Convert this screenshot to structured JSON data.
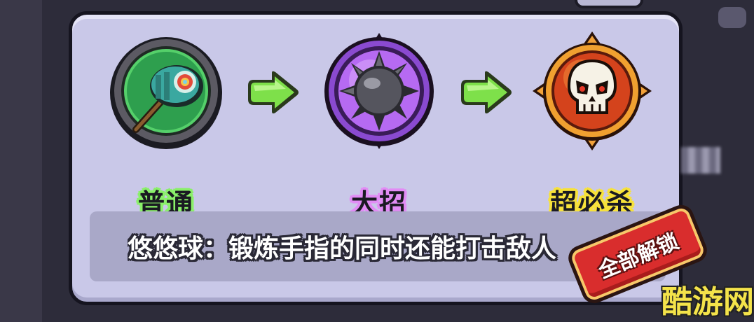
{
  "skills": [
    {
      "label": "普通",
      "icon": "yoyo-ball-icon"
    },
    {
      "label": "大招",
      "icon": "spiked-mace-ball-icon"
    },
    {
      "label": "超必杀",
      "icon": "skull-icon"
    }
  ],
  "description": "悠悠球：锻炼手指的同时还能打击敌人",
  "unlock_button": "全部解锁",
  "watermark": "酷游网",
  "colors": {
    "panel": "#c9c8e8",
    "green_label": "#8af06a",
    "purple_label": "#e28cf5",
    "yellow_label": "#f7e23a",
    "arrow": "#7ee04a",
    "button": "#d92d2d"
  }
}
